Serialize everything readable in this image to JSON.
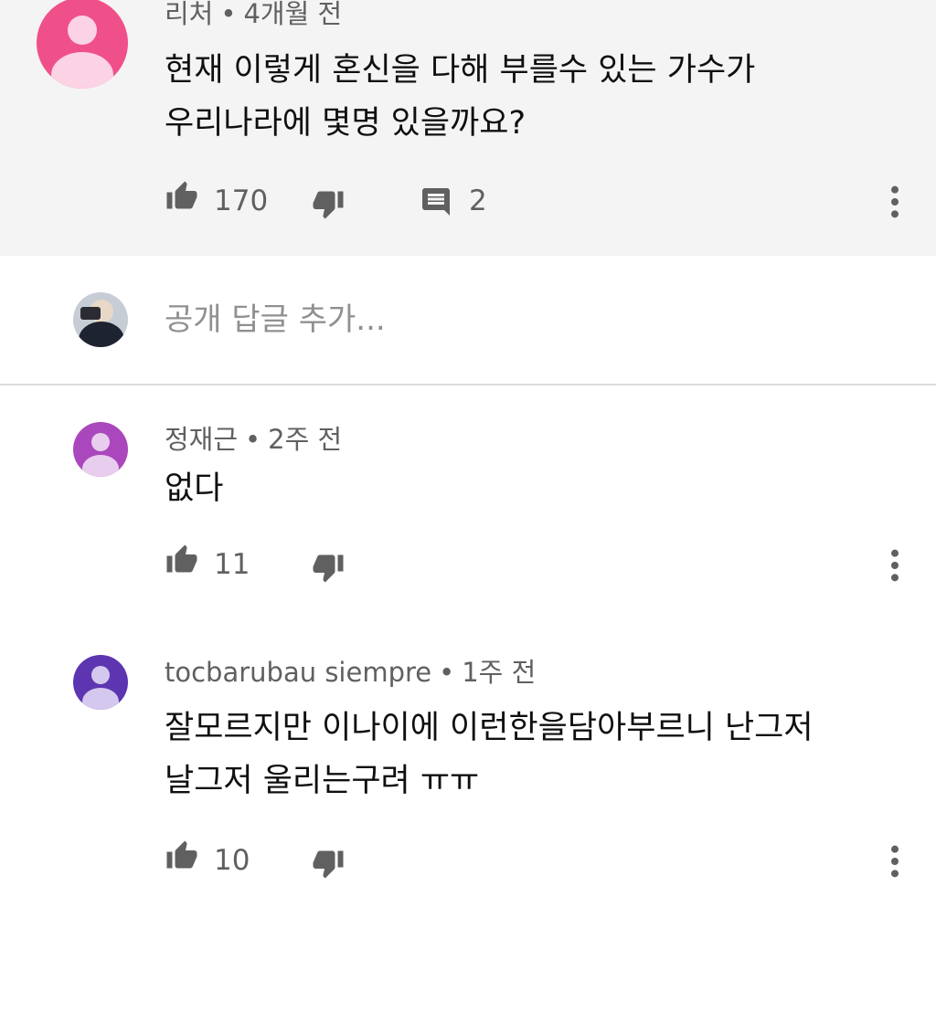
{
  "top_comment": {
    "author": "리처",
    "separator": "•",
    "time": "4개월 전",
    "text_lines": [
      "현재 이렇게 혼신을 다해 부를수 있는 가수가",
      "우리나라에 몇명 있을까요?"
    ],
    "likes": "170",
    "replies": "2",
    "avatar_color": "#f0508a"
  },
  "reply_box": {
    "placeholder": "공개 답글 추가..."
  },
  "replies": [
    {
      "author": "정재근",
      "time": "2주 전",
      "text_lines": [
        "없다"
      ],
      "likes": "11",
      "avatar_color": "#ab47bc"
    },
    {
      "author": "tocbarubau siempre",
      "time": "1주 전",
      "text_lines": [
        "잘모르지만 이나이에 이런한을담아부르니 난그저",
        "날그저 울리는구려 ㅠㅠ"
      ],
      "likes": "10",
      "avatar_color": "#5e35b1"
    }
  ],
  "icons": {
    "like": "thumb-up-icon",
    "dislike": "thumb-down-icon",
    "reply": "comment-icon",
    "more": "more-vert-icon"
  },
  "colors": {
    "highlight_bg": "#f4f4f4",
    "meta_text": "#606060",
    "icon": "#606060",
    "body_text": "#0f0f0f"
  }
}
